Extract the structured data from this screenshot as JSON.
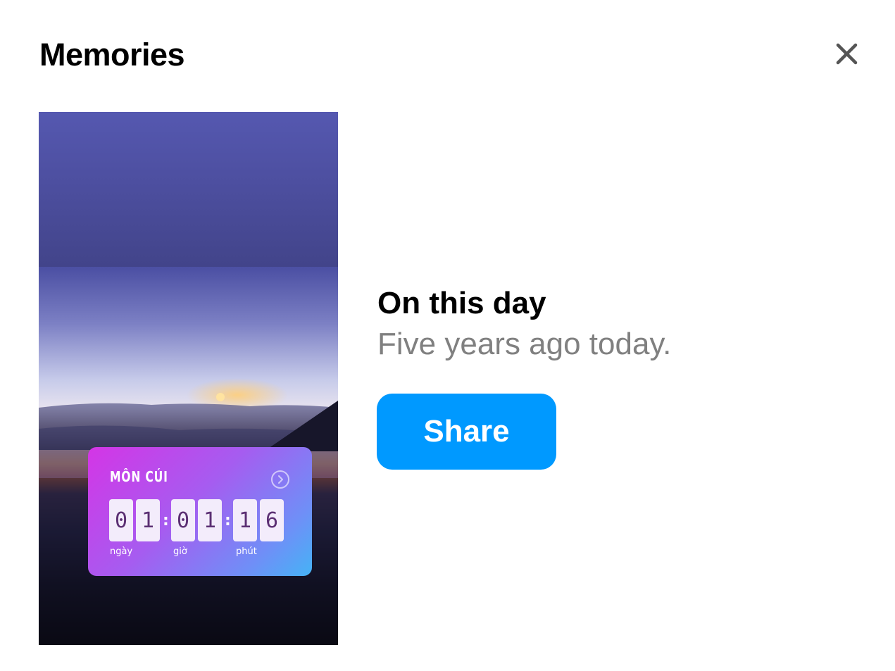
{
  "header": {
    "title": "Memories",
    "close_icon": "close-icon"
  },
  "memory": {
    "heading": "On this day",
    "subheading": "Five years ago today.",
    "share_label": "Share"
  },
  "thumbnail": {
    "countdown": {
      "title": "MÔN CÚI",
      "arrow_icon": "chevron-right-circle-icon",
      "digits": [
        "0",
        "1",
        "0",
        "1",
        "1",
        "6"
      ],
      "units": [
        "ngày",
        "giờ",
        "phút"
      ]
    }
  },
  "colors": {
    "accent": "#0099ff",
    "subheading": "#808080"
  }
}
